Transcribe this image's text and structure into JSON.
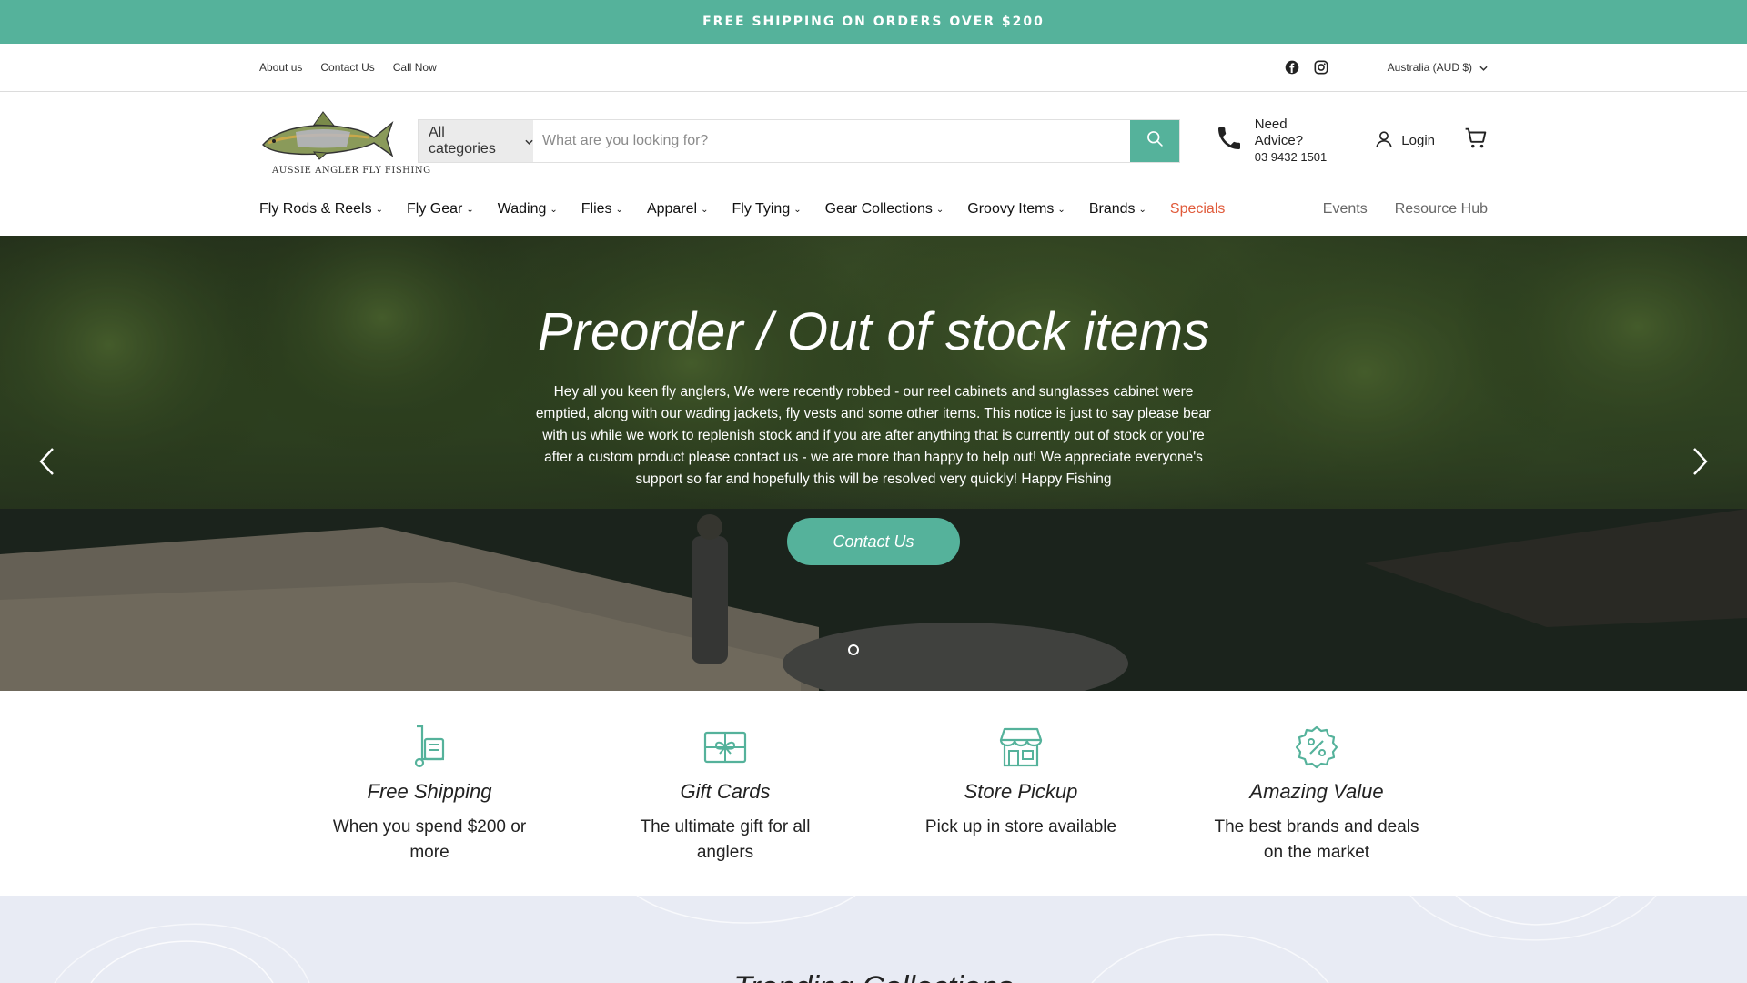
{
  "announcement": {
    "text": "FREE SHIPPING ON ORDERS OVER $200"
  },
  "utility": {
    "links": [
      "About us",
      "Contact Us",
      "Call Now"
    ],
    "currency": "Australia (AUD $)",
    "social": [
      "facebook-icon",
      "instagram-icon"
    ]
  },
  "header": {
    "logo_text": "AUSSIE ANGLER FLY FISHING",
    "search": {
      "category": "All categories",
      "placeholder": "What are you looking for?"
    },
    "advice": {
      "title": "Need Advice?",
      "phone": "03 9432 1501"
    },
    "login": "Login"
  },
  "nav": {
    "items": [
      "Fly Rods & Reels",
      "Fly Gear",
      "Wading",
      "Flies",
      "Apparel",
      "Fly Tying",
      "Gear Collections",
      "Groovy Items",
      "Brands"
    ],
    "special": "Specials",
    "right": [
      "Events",
      "Resource Hub"
    ]
  },
  "hero": {
    "title": "Preorder / Out of stock items",
    "body": "Hey all you keen fly anglers, We were recently robbed - our reel cabinets and sunglasses cabinet were emptied, along with our wading jackets, fly vests and some other items. This notice is just to say please bear with us while we work to replenish stock and if you are after anything that is currently out of stock or you're after a custom product please contact us - we are more than happy to help out! We appreciate everyone's support so far and hopefully this will be resolved very quickly! Happy Fishing",
    "cta": "Contact Us",
    "slides": 1
  },
  "features": [
    {
      "icon": "shipping-icon",
      "title": "Free Shipping",
      "desc": "When you spend $200 or more"
    },
    {
      "icon": "gift-card-icon",
      "title": "Gift Cards",
      "desc": "The ultimate gift for all anglers"
    },
    {
      "icon": "store-icon",
      "title": "Store Pickup",
      "desc": "Pick up in store available"
    },
    {
      "icon": "discount-icon",
      "title": "Amazing Value",
      "desc": "The best brands and deals on the market"
    }
  ],
  "trending": {
    "title": "Trending Collections"
  },
  "colors": {
    "accent": "#55b29b",
    "special": "#e05a3a",
    "trending_bg": "#e8ebf4"
  }
}
